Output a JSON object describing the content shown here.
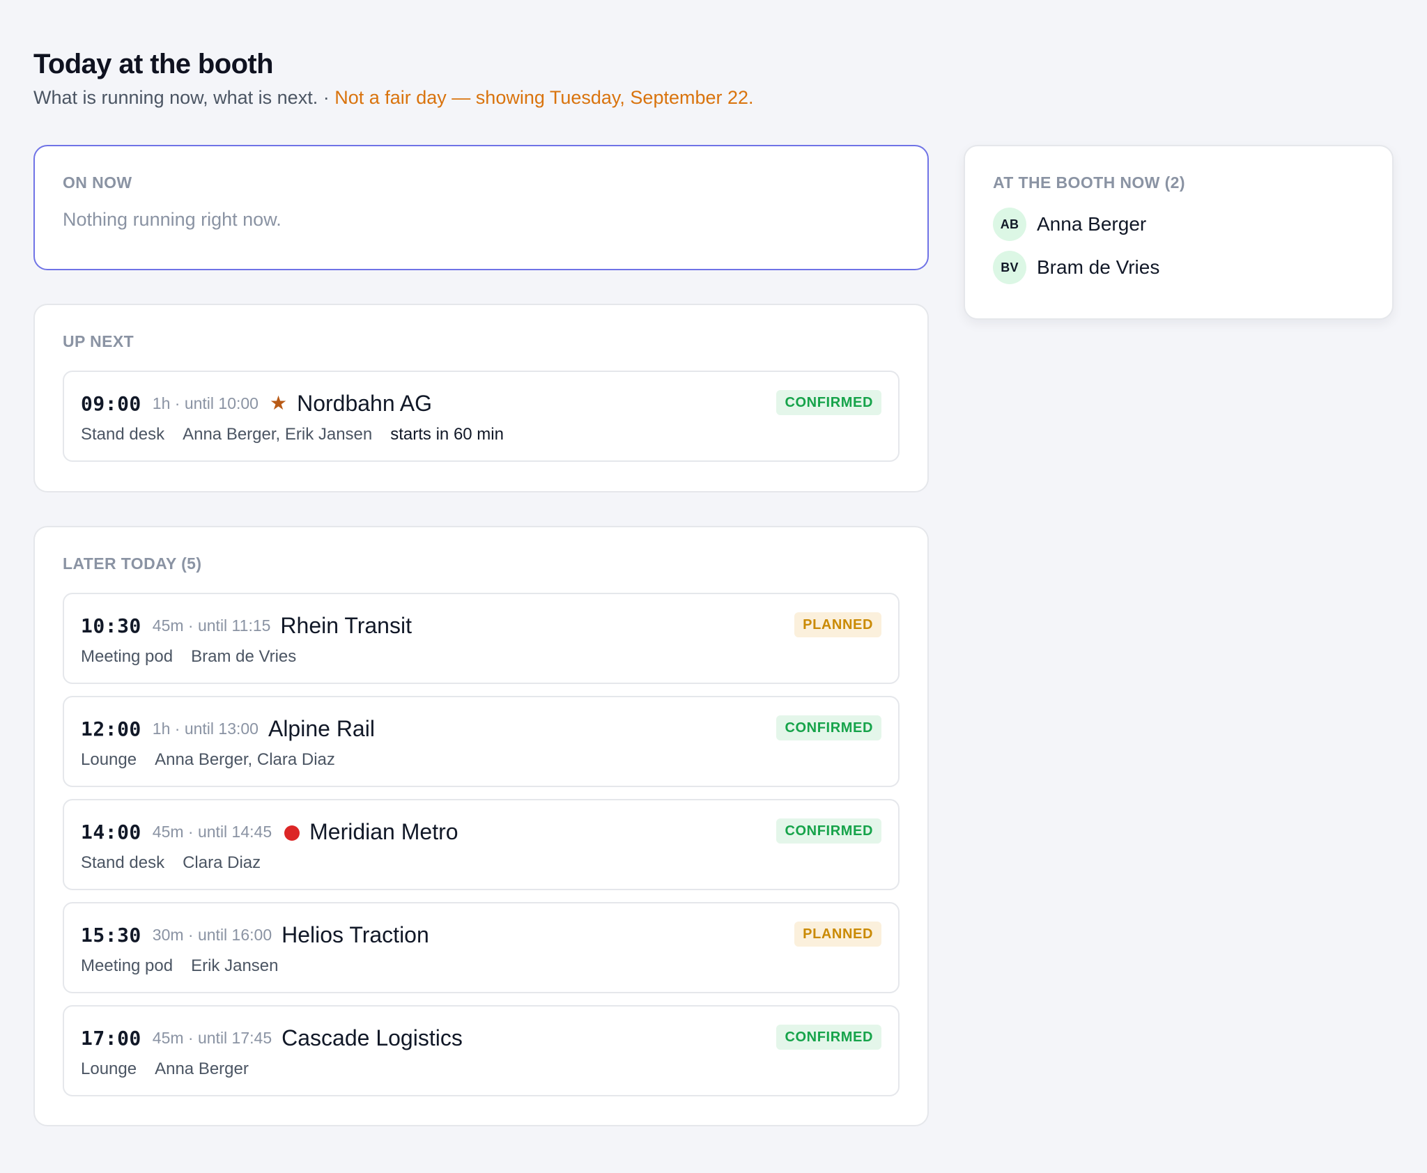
{
  "header": {
    "title": "Today at the booth",
    "subtitle": "What is running now, what is next.",
    "separator": " · ",
    "notice": "Not a fair day — showing Tuesday, September 22."
  },
  "on_now": {
    "label": "ON NOW",
    "empty_text": "Nothing running right now."
  },
  "up_next": {
    "label": "UP NEXT",
    "item": {
      "time": "09:00",
      "duration": "1h · until 10:00",
      "marker": "★",
      "name": "Nordbahn AG",
      "status": "CONFIRMED",
      "location": "Stand desk",
      "people": "Anna Berger, Erik Jansen",
      "starts_in": "starts in 60 min"
    }
  },
  "later_today": {
    "label": "LATER TODAY (5)",
    "items": [
      {
        "time": "10:30",
        "duration": "45m · until 11:15",
        "name": "Rhein Transit",
        "status": "PLANNED",
        "location": "Meeting pod",
        "people": "Bram de Vries"
      },
      {
        "time": "12:00",
        "duration": "1h · until 13:00",
        "name": "Alpine Rail",
        "status": "CONFIRMED",
        "location": "Lounge",
        "people": "Anna Berger, Clara Diaz"
      },
      {
        "time": "14:00",
        "duration": "45m · until 14:45",
        "marker_icon": "red-dot-icon",
        "name": "Meridian Metro",
        "status": "CONFIRMED",
        "location": "Stand desk",
        "people": "Clara Diaz"
      },
      {
        "time": "15:30",
        "duration": "30m · until 16:00",
        "name": "Helios Traction",
        "status": "PLANNED",
        "location": "Meeting pod",
        "people": "Erik Jansen"
      },
      {
        "time": "17:00",
        "duration": "45m · until 17:45",
        "name": "Cascade Logistics",
        "status": "CONFIRMED",
        "location": "Lounge",
        "people": "Anna Berger"
      }
    ]
  },
  "booth_now": {
    "label": "AT THE BOOTH NOW (2)",
    "people": [
      {
        "initials": "AB",
        "name": "Anna Berger"
      },
      {
        "initials": "BV",
        "name": "Bram de Vries"
      }
    ]
  },
  "colors": {
    "background": "#f4f5f9",
    "accent_border": "#6f73e6",
    "notice": "#d9730d",
    "confirmed_text": "#16a34a",
    "confirmed_bg": "#e4f6ea",
    "planned_text": "#ca8a04",
    "planned_bg": "#fbf0dc",
    "star": "#b85a16",
    "dot": "#dc2626",
    "avatar_bg": "#dcf7e5"
  }
}
